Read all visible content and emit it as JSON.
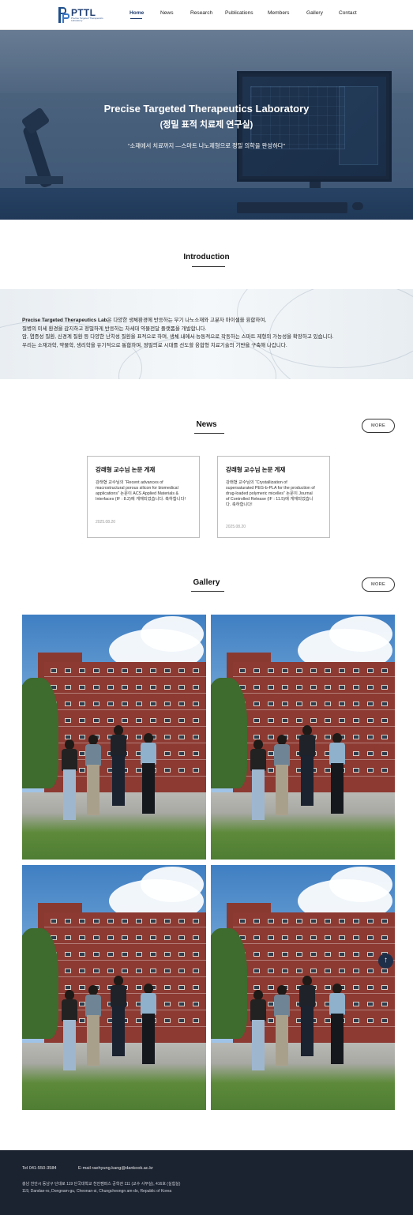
{
  "header": {
    "logo_text": "PTTL",
    "logo_sub": "Precise Targeted Therapeutics Laboratory",
    "nav": [
      "Home",
      "News",
      "Research",
      "Publications",
      "Members",
      "Gallery",
      "Contact"
    ],
    "active_nav": "Home"
  },
  "hero": {
    "title": "Precise Targeted Therapeutics Laboratory",
    "subtitle": "(정밀 표적 치료제 연구실)",
    "tagline": "“소재에서 치료까지 —스마트 나노제형으로 정밀 의학을 완성하다”"
  },
  "intro": {
    "title": "Introduction",
    "lab_name": "Precise Targeted Therapeutics Lab",
    "line1_rest": "은 다양한 생체환경에 반응하는 무기 나노소재와 고분자 마이셀을 융합하여,",
    "line2": "질병의 미세 환경을 감지하고 정밀하게 반응하는 차세대 약물전달 플랫폼을 개발합니다.",
    "line3": "암, 염증성 질환, 신경계 질환 등 다양한 난치성 질환을 표적으로 하며, 생체 내에서 능동적으로 작동하는 스마트 제형의 가능성을 확장하고 있습니다.",
    "line4": "우리는 소재과학, 약물학, 생리학을 유기적으로 통합하며, 정밀의료 시대를 선도할 융합형 치료기술의 기반을 구축해 나갑니다."
  },
  "news": {
    "title": "News",
    "more": "MORE",
    "cards": [
      {
        "title": "강래형 교수님 논문 게재",
        "body": "강래형 교수님의 “Recent advances of macrostructural porous silicon for biomedical applications” 논문이 ACS Applied Materials & Interfaces (IF : 8.2)에 게재되었습니다. 축하합니다!",
        "date": "2025.08.20"
      },
      {
        "title": "강래형 교수님 논문 게재",
        "body": "강래형 교수님의 “Crystallization of supersaturated PEG-b-PLA for the production of drug-loaded polymeric micelles” 논문이 Journal of Controlled Release (IF : 11.5)에 게재되었습니다. 축하합니다!",
        "date": "2025.08.20"
      }
    ]
  },
  "gallery": {
    "title": "Gallery",
    "more": "MORE"
  },
  "footer": {
    "tel": "Tel 041-550-3584",
    "email": "E-mail raehyung.kang@dankook.ac.kr",
    "address_ko": "충남 천안시 동남구 단대로 119 단국대학교 천안캠퍼스 공학관 111 (교수 사무실), 416호 (실험실)",
    "address_en": "119, Dandae-ro, Dongnam-gu, Cheonan-si, Chungcheongn am-do, Republic of Korea"
  },
  "top_button": "↑"
}
